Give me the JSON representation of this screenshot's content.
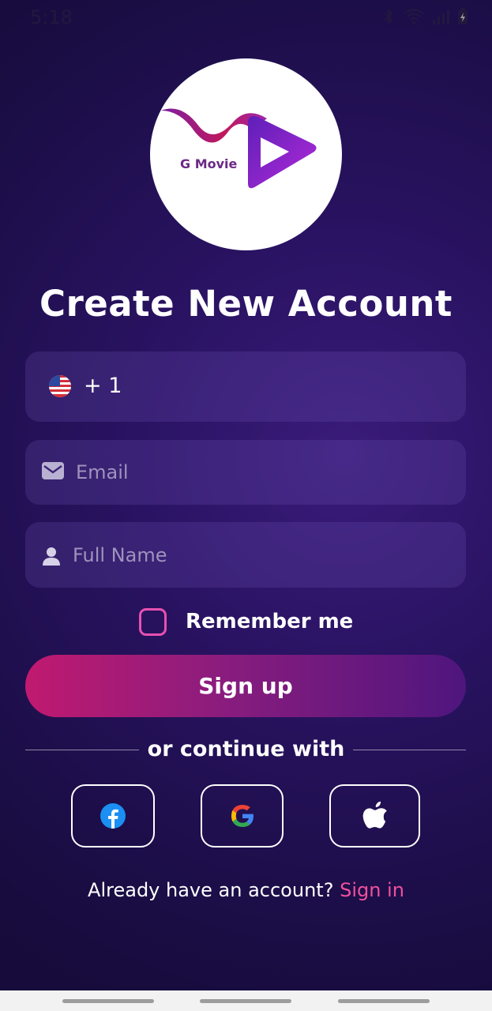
{
  "status_bar": {
    "time": "5:18",
    "icons": [
      "bluetooth-icon",
      "wifi-icon",
      "signal-icon",
      "battery-charging-icon"
    ]
  },
  "logo": {
    "text": "G Movie",
    "colors": {
      "ribbon": "#9b2cb8",
      "play": "#7a2ad6",
      "text": "#6b2a86"
    }
  },
  "title": "Create New Account",
  "phone_field": {
    "flag": "us-flag-icon",
    "code": "+ 1"
  },
  "email_field": {
    "placeholder": "Email",
    "value": "",
    "icon": "mail-icon"
  },
  "name_field": {
    "placeholder": "Full Name",
    "value": "",
    "icon": "person-icon"
  },
  "remember": {
    "label": "Remember me",
    "checked": false
  },
  "signup_button": {
    "label": "Sign up"
  },
  "divider": {
    "text": "or continue with"
  },
  "social": [
    {
      "name": "facebook",
      "icon": "facebook-icon"
    },
    {
      "name": "google",
      "icon": "google-icon"
    },
    {
      "name": "apple",
      "icon": "apple-icon"
    }
  ],
  "footer": {
    "prompt": "Already have an account?",
    "link": "Sign in"
  },
  "colors": {
    "background": "#1f0f52",
    "accent_pink": "#f0509d",
    "button_start": "#c01a6f",
    "button_end": "#4e167e",
    "field_bg": "#3a2473"
  }
}
